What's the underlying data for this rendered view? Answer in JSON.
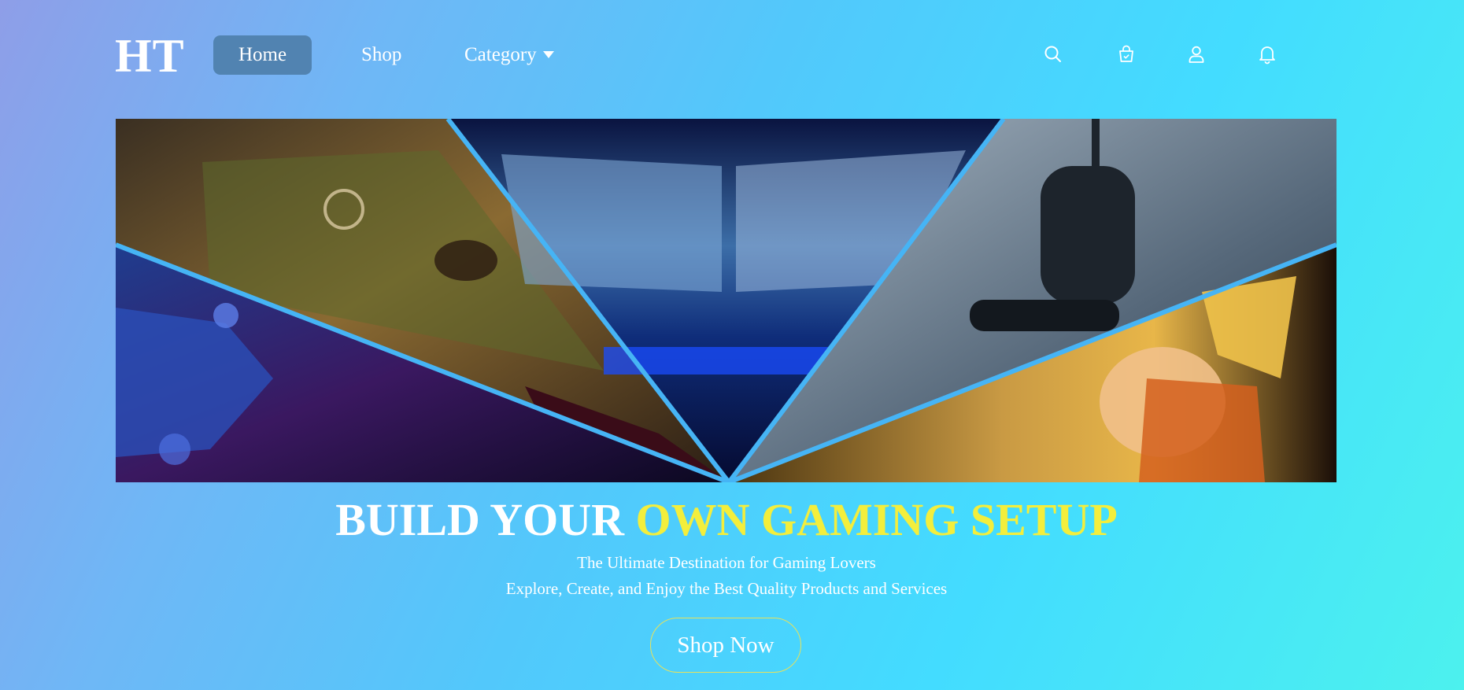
{
  "brand": {
    "logo": "HT"
  },
  "nav": {
    "items": [
      {
        "label": "Home",
        "active": true
      },
      {
        "label": "Shop",
        "active": false
      },
      {
        "label": "Category",
        "active": false
      }
    ]
  },
  "header_icons": [
    "search-icon",
    "shopping-bag-icon",
    "user-icon",
    "bell-icon"
  ],
  "hero": {
    "image_panels": [
      "gaming-laptop",
      "dual-monitor-desk",
      "gaming-chair",
      "game-controller",
      "anime-figure"
    ]
  },
  "headline": {
    "part1": "BUILD YOUR ",
    "part2": "OWN GAMING SETUP"
  },
  "tagline": {
    "line1": "The Ultimate Destination for Gaming Lovers",
    "line2": "Explore, Create, and Enjoy the Best Quality Products and Services"
  },
  "cta": {
    "label": "Shop Now"
  },
  "colors": {
    "accent_yellow": "#f3ee3c",
    "nav_active_bg": "#5183b1",
    "separator_blue": "#46b4f5"
  }
}
